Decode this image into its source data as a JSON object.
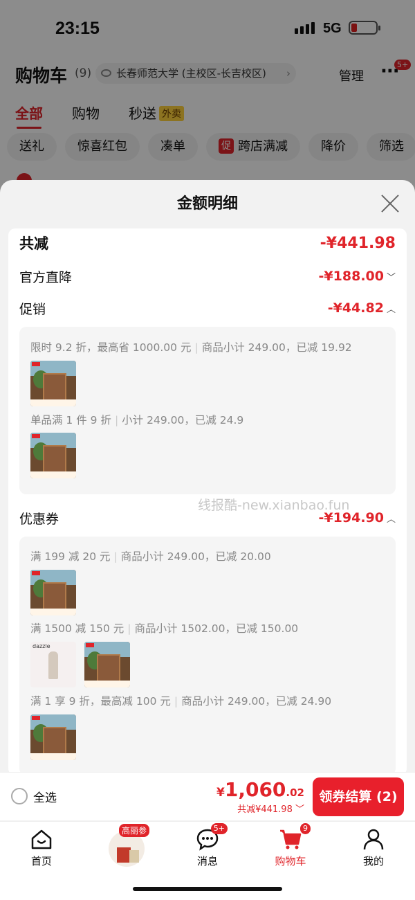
{
  "status": {
    "time": "23:15",
    "network": "5G"
  },
  "header": {
    "title": "购物车",
    "count": "(9)",
    "address": "长春师范大学 (主校区-长吉校区)",
    "manage": "管理",
    "more_badge": "5+"
  },
  "tabs": [
    {
      "label": "全部"
    },
    {
      "label": "购物"
    },
    {
      "label": "秒送"
    }
  ],
  "tab_tag": "外卖",
  "chips": [
    "送礼",
    "惊喜红包",
    "凑单",
    "跨店满减",
    "降价",
    "筛选"
  ],
  "chip_promo_icon": "促",
  "modal": {
    "title": "金额明细",
    "total": {
      "label": "共减",
      "value": "-¥441.98"
    },
    "official": {
      "label": "官方直降",
      "value": "-¥188.00"
    },
    "promo": {
      "label": "促销",
      "value": "-¥44.82",
      "line1": {
        "a": "限时 9.2 折，最高省 1000.00 元",
        "b": "商品小计 249.00，已减 19.92"
      },
      "line2": {
        "a": "单品满 1 件 9 折",
        "b": "小计 249.00，已减 24.9"
      }
    },
    "coupon": {
      "label": "优惠券",
      "value": "-¥194.90",
      "line1": {
        "a": "满 199 减 20 元",
        "b": "商品小计 249.00，已减 20.00"
      },
      "line2": {
        "a": "满 1500 减 150 元",
        "b": "商品小计 1502.00，已减 150.00"
      },
      "line3": {
        "a": "满 1 享 9 折，最高减 100 元",
        "b": "商品小计 249.00，已减 24.90"
      }
    },
    "watermark": "线报酷-new.xianbao.fun"
  },
  "bottom": {
    "select_all": "全选",
    "currency": "¥",
    "price_int": "1,060",
    "price_dec": ".02",
    "saved": "共减¥441.98",
    "checkout": "领券结算 (2)"
  },
  "nav": {
    "home": "首页",
    "ad_label": "高丽参",
    "messages": "消息",
    "messages_badge": "5+",
    "cart": "购物车",
    "cart_badge": "9",
    "me": "我的"
  },
  "colors": {
    "accent": "#e0242a",
    "bg": "#f2f2f2"
  }
}
